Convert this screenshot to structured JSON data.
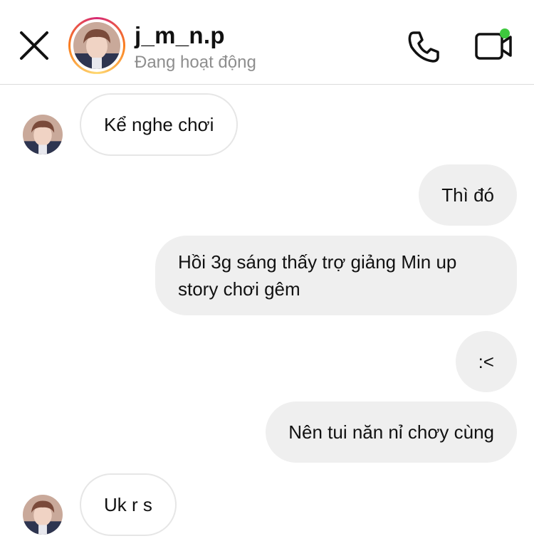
{
  "header": {
    "username": "j_m_n.p",
    "status": "Đang hoạt động"
  },
  "messages": [
    {
      "from": "them",
      "text": "Kể nghe chơi"
    },
    {
      "from": "me",
      "text": "Thì đó"
    },
    {
      "from": "me",
      "text": "Hồi 3g sáng thấy trợ giảng Min up story chơi gêm"
    },
    {
      "from": "me",
      "text": ":<"
    },
    {
      "from": "me",
      "text": "Nên tui năn nỉ chơy cùng"
    },
    {
      "from": "them",
      "text": "Uk r s"
    }
  ],
  "colors": {
    "online_dot": "#3ec83e",
    "outgoing_bubble": "#efefef",
    "status_text": "#8e8e8e"
  }
}
